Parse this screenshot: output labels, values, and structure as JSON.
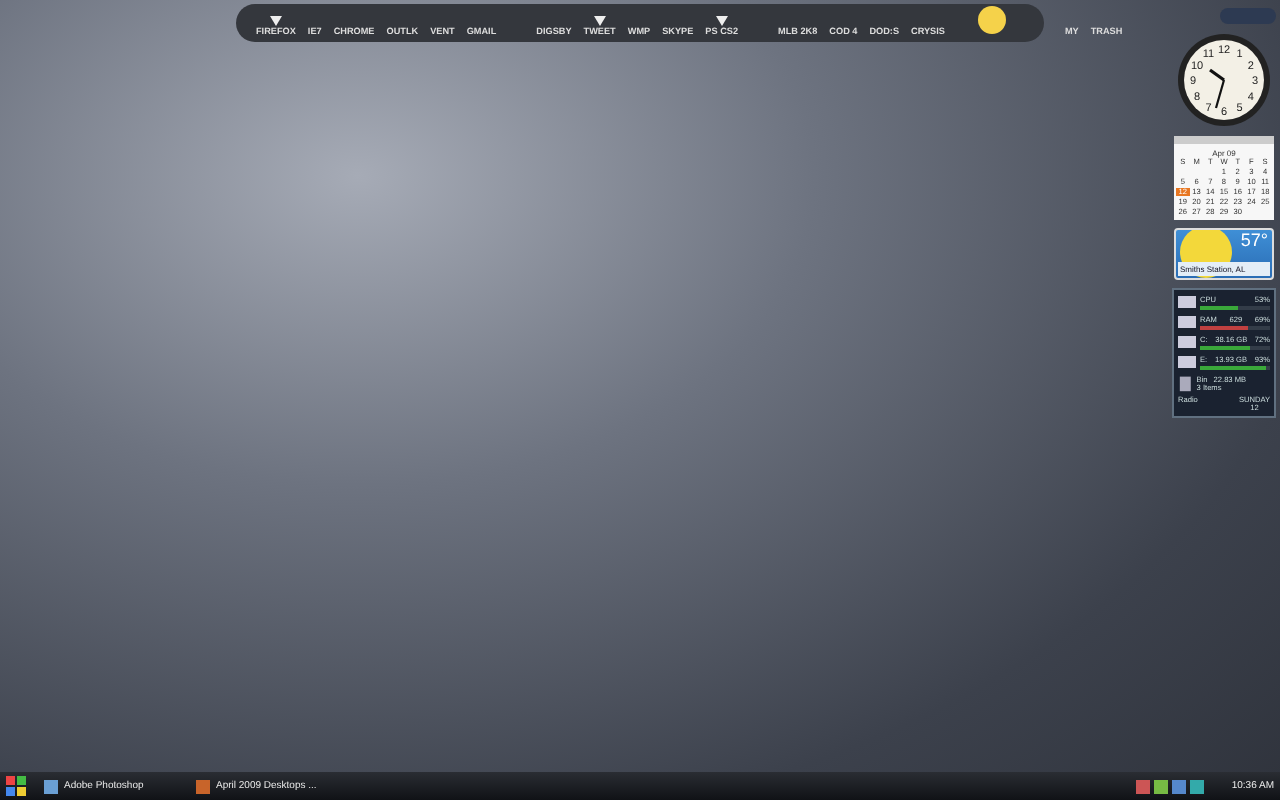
{
  "dock": {
    "groups": [
      [
        {
          "label": "FIREFOX",
          "running": true
        },
        {
          "label": "IE7",
          "running": false
        },
        {
          "label": "CHROME",
          "running": false
        },
        {
          "label": "OUTLK",
          "running": false
        },
        {
          "label": "VENT",
          "running": false
        },
        {
          "label": "GMAIL",
          "running": false
        }
      ],
      [
        {
          "label": "DIGSBY",
          "running": false
        },
        {
          "label": "TWEET",
          "running": true
        },
        {
          "label": "WMP",
          "running": false
        },
        {
          "label": "SKYPE",
          "running": false
        },
        {
          "label": "PS CS2",
          "running": true
        }
      ],
      [
        {
          "label": "MLB 2K8",
          "running": false
        },
        {
          "label": "COD 4",
          "running": false
        },
        {
          "label": "DOD:S",
          "running": false
        },
        {
          "label": "CRYSIS",
          "running": false
        }
      ],
      [
        {
          "label": "MY",
          "running": false
        },
        {
          "label": "TRASH",
          "running": false
        }
      ]
    ]
  },
  "clock": {
    "numerals": [
      "12",
      "11",
      "1",
      "10",
      "2",
      "9",
      "3",
      "8",
      "4",
      "7",
      "5",
      "6"
    ]
  },
  "calendar": {
    "month": "Apr 09",
    "weekdays": [
      "S",
      "M",
      "T",
      "W",
      "T",
      "F",
      "S"
    ],
    "days": [
      {
        "day": "1",
        "selected": false
      },
      {
        "day": "2",
        "selected": false
      },
      {
        "day": "3",
        "selected": false
      },
      {
        "day": "4",
        "selected": false
      },
      {
        "day": "5",
        "selected": false
      },
      {
        "day": "6",
        "selected": false
      },
      {
        "day": "7",
        "selected": false
      },
      {
        "day": "8",
        "selected": false
      },
      {
        "day": "9",
        "selected": false
      },
      {
        "day": "10",
        "selected": false
      },
      {
        "day": "11",
        "selected": false
      },
      {
        "day": "12",
        "selected": true
      },
      {
        "day": "13",
        "selected": false
      },
      {
        "day": "14",
        "selected": false
      },
      {
        "day": "15",
        "selected": false
      },
      {
        "day": "16",
        "selected": false
      },
      {
        "day": "17",
        "selected": false
      },
      {
        "day": "18",
        "selected": false
      },
      {
        "day": "19",
        "selected": false
      },
      {
        "day": "20",
        "selected": false
      },
      {
        "day": "21",
        "selected": false
      },
      {
        "day": "22",
        "selected": false
      },
      {
        "day": "23",
        "selected": false
      },
      {
        "day": "24",
        "selected": false
      },
      {
        "day": "25",
        "selected": false
      },
      {
        "day": "26",
        "selected": false
      },
      {
        "day": "27",
        "selected": false
      },
      {
        "day": "28",
        "selected": false
      },
      {
        "day": "29",
        "selected": false
      },
      {
        "day": "30",
        "selected": false
      }
    ]
  },
  "weather": {
    "temperature": "57°",
    "location": "Smiths Station, AL"
  },
  "monitor": {
    "rows": [
      {
        "kind": "bar",
        "label": "CPU",
        "value": "",
        "percent": "53%",
        "level": 0.53,
        "color": "#3aa83a"
      },
      {
        "kind": "bar",
        "label": "RAM",
        "value": "629",
        "percent": "69%",
        "level": 0.69,
        "color": "#c04040"
      },
      {
        "kind": "bar",
        "label": "C:",
        "value": "38.16 GB",
        "percent": "72%",
        "level": 0.72,
        "color": "#3aa83a"
      },
      {
        "kind": "bar",
        "label": "E:",
        "value": "13.93 GB",
        "percent": "93%",
        "level": 0.93,
        "color": "#3aa83a"
      }
    ],
    "bin": {
      "label": "Bin",
      "size": "22.83 MB",
      "items": "3 Items"
    },
    "radio": "Radio",
    "day": "SUNDAY",
    "date": "12"
  },
  "taskbar": {
    "tasks": [
      {
        "label": "Adobe Photoshop",
        "selected": false
      },
      {
        "label": "April 2009 Desktops ...",
        "selected": false
      }
    ],
    "time": "10:36 AM"
  }
}
